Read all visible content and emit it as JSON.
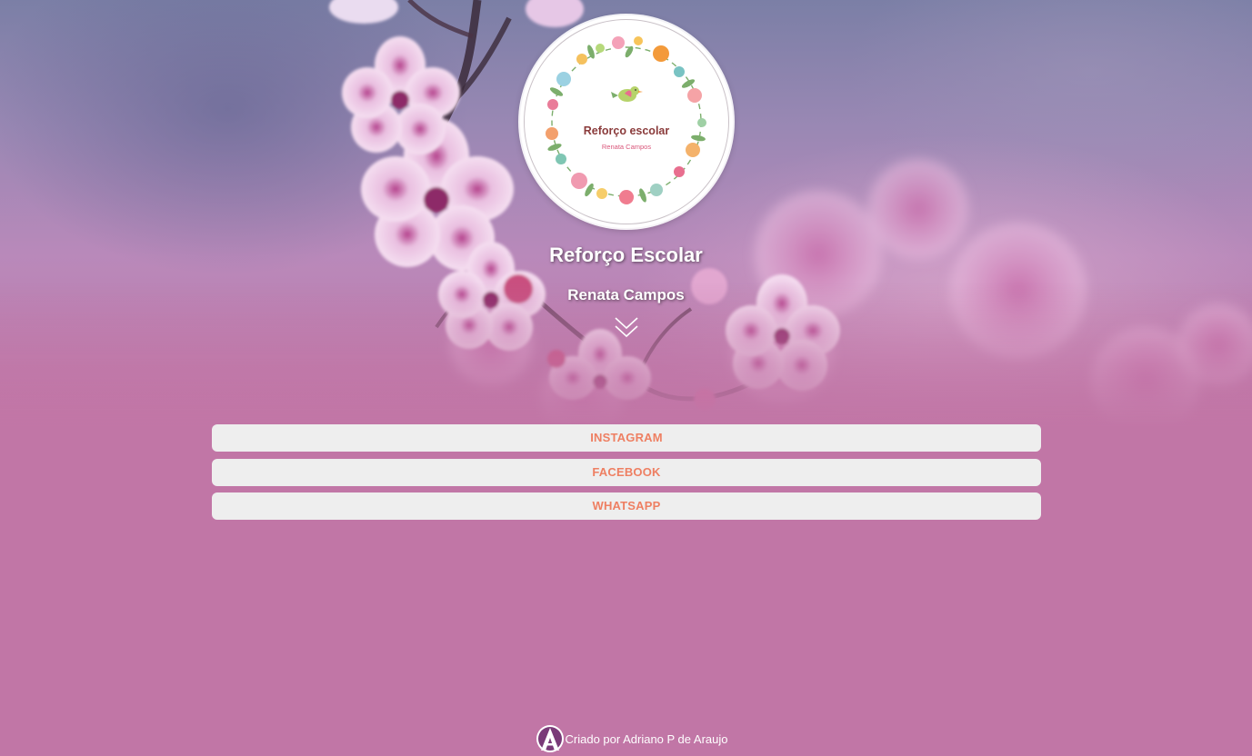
{
  "logo": {
    "title": "Reforço escolar",
    "subtitle": "Renata Campos",
    "icon": "floral-wreath-logo"
  },
  "header": {
    "title": "Reforço Escolar",
    "subtitle": "Renata Campos",
    "scroll_icon": "double-chevron-down-icon"
  },
  "links": [
    {
      "label": "INSTAGRAM"
    },
    {
      "label": "FACEBOOK"
    },
    {
      "label": "WHATSAPP"
    }
  ],
  "footer": {
    "credit": "Criado por Adriano P de Araujo",
    "author_logo_icon": "letter-a-logo-icon"
  },
  "colors": {
    "background": "#c176a6",
    "button_bg": "#eeeeee",
    "button_text": "#ee7f62",
    "title_text": "#ffffff"
  }
}
